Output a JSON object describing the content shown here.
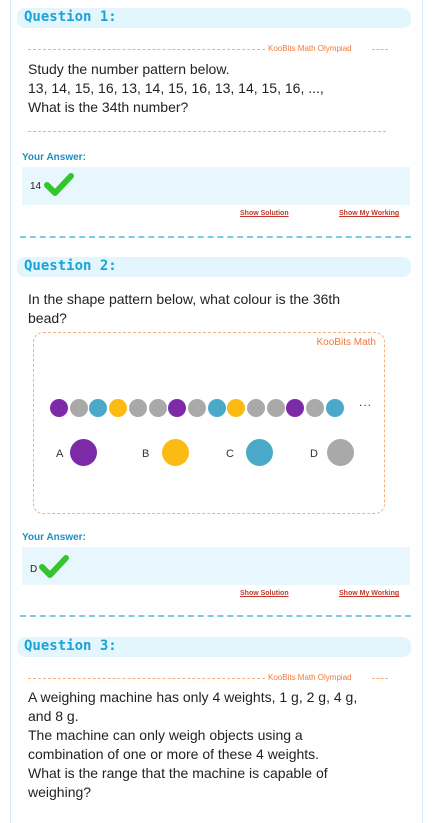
{
  "colors": {
    "purple": "#7d2aa8",
    "gray": "#a9a9a9",
    "blue": "#4aa9c8",
    "yellow": "#fcbb13",
    "check": "#33c52b"
  },
  "watermark": "KooBits Math Olympiad",
  "answer_label": "Your Answer:",
  "show_solution": "Show Solution",
  "show_working": "Show My Working",
  "q1": {
    "title": "Question 1:",
    "lines": [
      "Study the number pattern below.",
      "13, 14, 15, 16, 13, 14, 15, 16, 13, 14, 15, 16, ...,",
      "What is the 34th number?"
    ],
    "answer": "14"
  },
  "q2": {
    "title": "Question 2:",
    "lines": [
      "In the shape pattern below, what colour is the 36th",
      "bead?"
    ],
    "figure_watermark": "KooBits Math",
    "beads": [
      "purple",
      "gray",
      "blue",
      "yellow",
      "gray",
      "gray",
      "purple",
      "gray",
      "blue",
      "yellow",
      "gray",
      "gray",
      "purple",
      "gray",
      "blue"
    ],
    "ellipsis": "...",
    "options": [
      {
        "letter": "A",
        "color": "purple"
      },
      {
        "letter": "B",
        "color": "yellow"
      },
      {
        "letter": "C",
        "color": "blue"
      },
      {
        "letter": "D",
        "color": "gray"
      }
    ],
    "answer": "D"
  },
  "q3": {
    "title": "Question 3:",
    "lines": [
      "A weighing machine has only 4 weights, 1 g, 2 g, 4 g,",
      "and 8 g.",
      "The machine can only weigh objects using a",
      "combination of one or more of these 4 weights.",
      "What is the range that the machine is capable of",
      "weighing?"
    ]
  }
}
